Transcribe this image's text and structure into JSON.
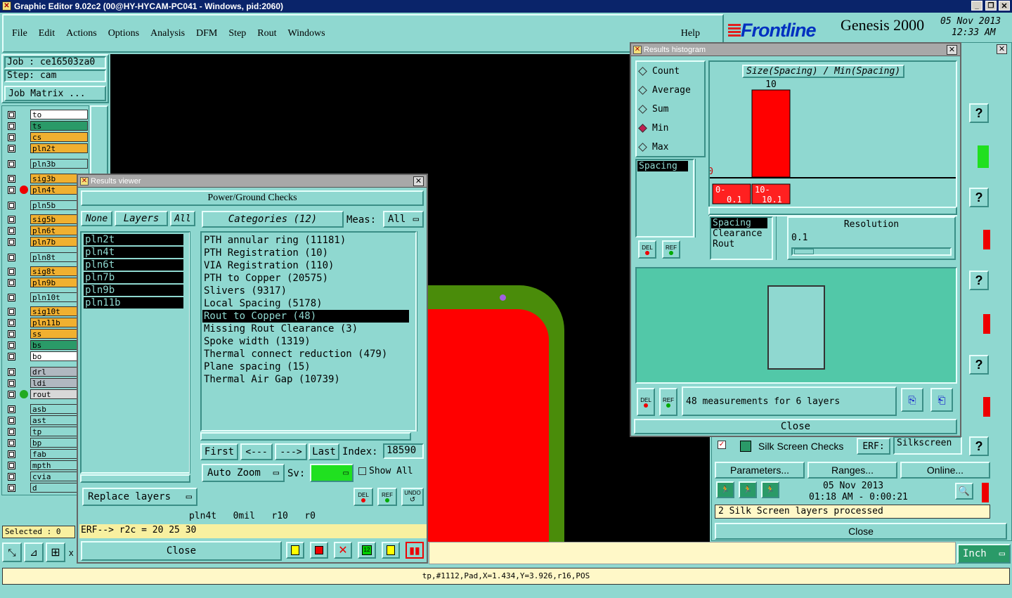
{
  "window_title": "Graphic Editor 9.02c2 (00@HY-HYCAM-PC041 - Windows, pid:2060)",
  "menu": [
    "File",
    "Edit",
    "Actions",
    "Options",
    "Analysis",
    "DFM",
    "Step",
    "Rout",
    "Windows"
  ],
  "help": "Help",
  "brand": {
    "logo": "Frontline",
    "product": "Genesis 2000",
    "date": "05 Nov 2013",
    "time": "12:33 AM"
  },
  "job": {
    "job": "Job : ce16503za0",
    "step": "Step: cam",
    "matrix_btn": "Job Matrix ..."
  },
  "layers": [
    {
      "name": "to",
      "color": "#ffffff"
    },
    {
      "name": "ts",
      "color": "#2a9a68"
    },
    {
      "name": "cs",
      "color": "#f0b030"
    },
    {
      "name": "pln2t",
      "color": "#f0b030"
    },
    {
      "name": "pln3b",
      "color": "#8fd8d0"
    },
    {
      "name": "sig3b",
      "color": "#f0b030"
    },
    {
      "name": "pln4t",
      "color": "#f0b030"
    },
    {
      "name": "pln5b",
      "color": "#8fd8d0"
    },
    {
      "name": "sig5b",
      "color": "#f0b030"
    },
    {
      "name": "pln6t",
      "color": "#f0b030"
    },
    {
      "name": "pln7b",
      "color": "#f0b030"
    },
    {
      "name": "pln8t",
      "color": "#8fd8d0"
    },
    {
      "name": "sig8t",
      "color": "#f0b030"
    },
    {
      "name": "pln9b",
      "color": "#f0b030"
    },
    {
      "name": "pln10t",
      "color": "#8fd8d0"
    },
    {
      "name": "sig10t",
      "color": "#f0b030"
    },
    {
      "name": "pln11b",
      "color": "#f0b030"
    },
    {
      "name": "ss",
      "color": "#f0b030"
    },
    {
      "name": "bs",
      "color": "#2a9a68"
    },
    {
      "name": "bo",
      "color": "#ffffff"
    },
    {
      "name": "drl",
      "color": "#b0b8c0"
    },
    {
      "name": "ldi",
      "color": "#b0b8c0"
    },
    {
      "name": "rout",
      "color": "#d8d8d8"
    },
    {
      "name": "asb",
      "color": "#8fd8d0"
    },
    {
      "name": "ast",
      "color": "#8fd8d0"
    },
    {
      "name": "tp",
      "color": "#8fd8d0"
    },
    {
      "name": "bp",
      "color": "#8fd8d0"
    },
    {
      "name": "fab",
      "color": "#8fd8d0"
    },
    {
      "name": "mpth",
      "color": "#8fd8d0"
    },
    {
      "name": "cvia",
      "color": "#8fd8d0"
    },
    {
      "name": "d",
      "color": "#8fd8d0"
    }
  ],
  "selected": "Selected : 0",
  "results_viewer": {
    "title": "Results viewer",
    "header": "Power/Ground Checks",
    "none": "None",
    "layers_tab": "Layers",
    "all": "All",
    "categories_label": "Categories (12)",
    "meas_label": "Meas:",
    "meas_value": "All",
    "layers": [
      "pln2t",
      "pln4t",
      "pln6t",
      "pln7b",
      "pln9b",
      "pln11b"
    ],
    "categories": [
      "PTH annular ring (11181)",
      "PTH Registration (10)",
      "VIA Registration (110)",
      "PTH to Copper (20575)",
      "Slivers (9317)",
      "Local Spacing (5178)",
      "Rout to Copper (48)",
      "Missing Rout Clearance (3)",
      "Spoke width (1319)",
      "Thermal connect reduction (479)",
      "Plane spacing (15)",
      "Thermal Air Gap (10739)"
    ],
    "nav": {
      "first": "First",
      "prev": "<---",
      "next": "--->",
      "last": "Last",
      "index_label": "Index:",
      "index_value": "18590"
    },
    "auto_zoom": "Auto Zoom",
    "sv": "Sv:",
    "show_all": "Show All",
    "replace": "Replace layers",
    "del": "DEL",
    "ref": "REF",
    "undo": "UNDO",
    "info": "pln4t   0mil   r10   r0",
    "erf": "ERF--> r2c = 20 25 30",
    "close": "Close"
  },
  "histogram": {
    "title": "Results histogram",
    "modes": [
      "Count",
      "Average",
      "Sum",
      "Min",
      "Max"
    ],
    "selected_mode": "Min",
    "list_item": "Spacing",
    "chart_title": "Size(Spacing) / Min(Spacing)",
    "bins": [
      "0-\n0.1",
      "10-\n10.1"
    ],
    "bin_labels": [
      [
        "0-",
        "0.1"
      ],
      [
        "10-",
        "10.1"
      ]
    ],
    "res_items": [
      "Spacing",
      "Clearance",
      "Rout"
    ],
    "resolution_label": "Resolution",
    "resolution_value": "0.1",
    "status": "48 measurements for 6 layers",
    "close": "Close",
    "del": "DEL",
    "ref": "REF"
  },
  "chart_data": {
    "type": "bar",
    "title": "Size(Spacing) / Min(Spacing)",
    "categories": [
      "0-0.1",
      "10-10.1"
    ],
    "values": [
      0,
      10
    ]
  },
  "silk": {
    "label": "Silk Screen Checks",
    "erf": "ERF:",
    "erf_value": "Silkscreen",
    "params": "Parameters...",
    "ranges": "Ranges...",
    "online": "Online...",
    "date": "05 Nov 2013",
    "time": "01:18 AM - 0:00:21",
    "status": "2 Silk Screen layers processed",
    "close": "Close"
  },
  "units": "Inch",
  "status_bar": "tp,#1112,Pad,X=1.434,Y=3.926,r16,POS",
  "colors": {
    "panel": "#8fd8d0",
    "canvas": "#000000",
    "pad_red": "#ff0000",
    "outline_green": "#4a8c0a"
  }
}
